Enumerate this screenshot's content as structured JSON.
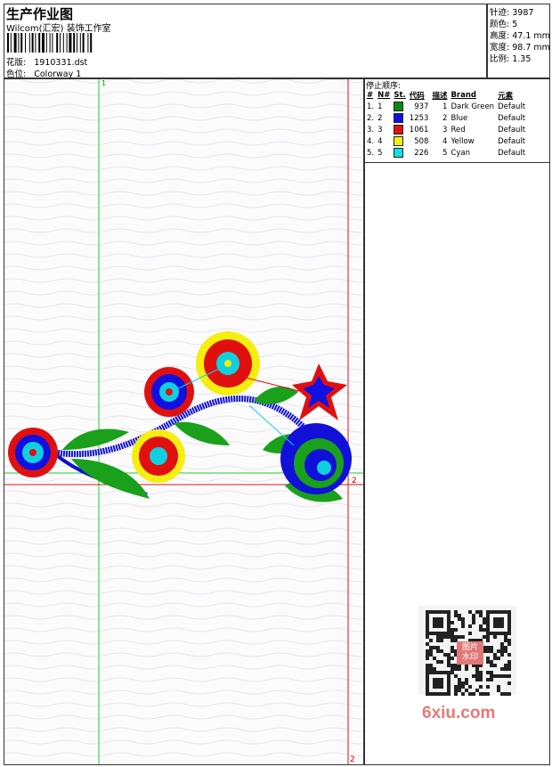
{
  "header": {
    "title": "生产作业图",
    "studio": "Wilcom(汇宏) 装饰工作室",
    "design_label": "花版:",
    "design_value": "1910331.dst",
    "colorway_label": "色位:",
    "colorway_value": "Colorway 1"
  },
  "stats": [
    {
      "label": "针迹:",
      "value": "3987"
    },
    {
      "label": "颜色:",
      "value": "5"
    },
    {
      "label": "高度:",
      "value": "47.1 mm"
    },
    {
      "label": "宽度:",
      "value": "98.7 mm"
    },
    {
      "label": "比例:",
      "value": "1.35"
    }
  ],
  "stop_sequence": {
    "title": "停止顺序:",
    "headers": [
      "#",
      "N#",
      "St.",
      "代码",
      "描述",
      "Brand",
      "元素"
    ],
    "rows": [
      {
        "num": "1.",
        "n": "1",
        "color": "#0c8a0c",
        "st": "937",
        "code": "1",
        "desc": "Dark Green",
        "brand": "Default"
      },
      {
        "num": "2.",
        "n": "2",
        "color": "#1010e0",
        "st": "1253",
        "code": "2",
        "desc": "Blue",
        "brand": "Default"
      },
      {
        "num": "3.",
        "n": "3",
        "color": "#e01010",
        "st": "1061",
        "code": "3",
        "desc": "Red",
        "brand": "Default"
      },
      {
        "num": "4.",
        "n": "4",
        "color": "#f0f010",
        "st": "508",
        "code": "4",
        "desc": "Yellow",
        "brand": "Default"
      },
      {
        "num": "5.",
        "n": "5",
        "color": "#10e0e0",
        "st": "226",
        "code": "5",
        "desc": "Cyan",
        "brand": "Default"
      }
    ]
  },
  "canvas": {
    "marker_green": "1",
    "marker_red_h": "2",
    "marker_red_v": "2"
  },
  "watermark": {
    "text": "6xiu.com",
    "stamp": "图片水印"
  }
}
